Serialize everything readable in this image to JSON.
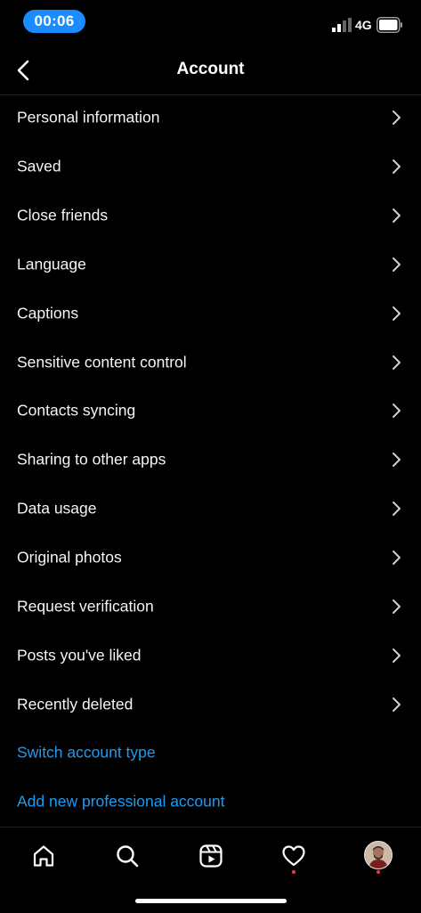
{
  "status_bar": {
    "time": "00:06",
    "network": "4G"
  },
  "header": {
    "title": "Account"
  },
  "menu": {
    "items": [
      {
        "label": "Personal information"
      },
      {
        "label": "Saved"
      },
      {
        "label": "Close friends"
      },
      {
        "label": "Language"
      },
      {
        "label": "Captions"
      },
      {
        "label": "Sensitive content control"
      },
      {
        "label": "Contacts syncing"
      },
      {
        "label": "Sharing to other apps"
      },
      {
        "label": "Data usage"
      },
      {
        "label": "Original photos"
      },
      {
        "label": "Request verification"
      },
      {
        "label": "Posts you've liked"
      },
      {
        "label": "Recently deleted"
      }
    ],
    "links": [
      {
        "label": "Switch account type"
      },
      {
        "label": "Add new professional account"
      }
    ]
  },
  "bottom_nav": {
    "items": [
      {
        "icon": "home-icon"
      },
      {
        "icon": "search-icon"
      },
      {
        "icon": "reels-icon"
      },
      {
        "icon": "heart-icon",
        "badge": true
      },
      {
        "icon": "profile-avatar",
        "badge": true
      }
    ]
  },
  "colors": {
    "background": "#000000",
    "link": "#1f9bf0",
    "time_pill": "#1a8cff",
    "notification_dot": "#ff3040"
  }
}
